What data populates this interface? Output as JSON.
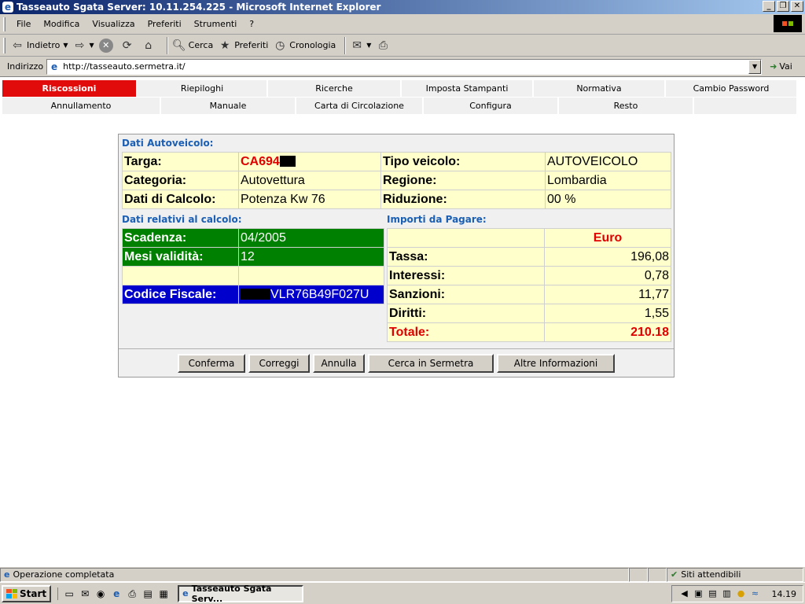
{
  "window": {
    "title": "Tasseauto Sgata Server: 10.11.254.225 - Microsoft Internet Explorer",
    "minimize_glyph": "_",
    "restore_glyph": "❐",
    "close_glyph": "✕"
  },
  "menu": {
    "items": [
      "File",
      "Modifica",
      "Visualizza",
      "Preferiti",
      "Strumenti",
      "?"
    ]
  },
  "toolbar": {
    "back_label": "Indietro",
    "search_label": "Cerca",
    "favorites_label": "Preferiti",
    "history_label": "Cronologia"
  },
  "address": {
    "label": "Indirizzo",
    "url": "http://tasseauto.sermetra.it/",
    "go_label": "Vai"
  },
  "nav": {
    "row1": [
      "Riscossioni",
      "Riepiloghi",
      "Ricerche",
      "Imposta Stampanti",
      "Normativa",
      "Cambio Password"
    ],
    "row2": [
      "Annullamento",
      "Manuale",
      "Carta di Circolazione",
      "Configura",
      "Resto"
    ]
  },
  "vehicle": {
    "section_title": "Dati Autoveicolo:",
    "targa_label": "Targa:",
    "targa_value": "CA694",
    "tipo_label": "Tipo veicolo:",
    "tipo_value": "AUTOVEICOLO",
    "categoria_label": "Categoria:",
    "categoria_value": "Autovettura",
    "regione_label": "Regione:",
    "regione_value": "Lombardia",
    "calcolo_label": "Dati di Calcolo:",
    "calcolo_value": "Potenza Kw 76",
    "riduzione_label": "Riduzione:",
    "riduzione_value": "00 %"
  },
  "calc": {
    "section_title": "Dati relativi al calcolo:",
    "scadenza_label": "Scadenza:",
    "scadenza_value": "04/2005",
    "mesi_label": "Mesi validità:",
    "mesi_value": "12",
    "cf_label": "Codice Fiscale:",
    "cf_value": "VLR76B49F027U"
  },
  "amounts": {
    "section_title": "Importi da Pagare:",
    "currency": "Euro",
    "rows": [
      {
        "label": "Tassa:",
        "value": "196,08"
      },
      {
        "label": "Interessi:",
        "value": "0,78"
      },
      {
        "label": "Sanzioni:",
        "value": "11,77"
      },
      {
        "label": "Diritti:",
        "value": "1,55"
      }
    ],
    "total_label": "Totale:",
    "total_value": "210.18"
  },
  "buttons": {
    "conferma": "Conferma",
    "correggi": "Correggi",
    "annulla": "Annulla",
    "cerca": "Cerca in Sermetra",
    "altre": "Altre Informazioni"
  },
  "status": {
    "left": "Operazione completata",
    "zone": "Siti attendibili"
  },
  "taskbar": {
    "start": "Start",
    "task": "Tasseauto Sgata Serv...",
    "clock": "14.19"
  },
  "colors": {
    "active_tab": "#e10b0b",
    "section_title": "#1a5fb4",
    "table_bg": "#ffffcc",
    "green_row": "#008000",
    "blue_row": "#0000cc",
    "total_red": "#e00000"
  }
}
